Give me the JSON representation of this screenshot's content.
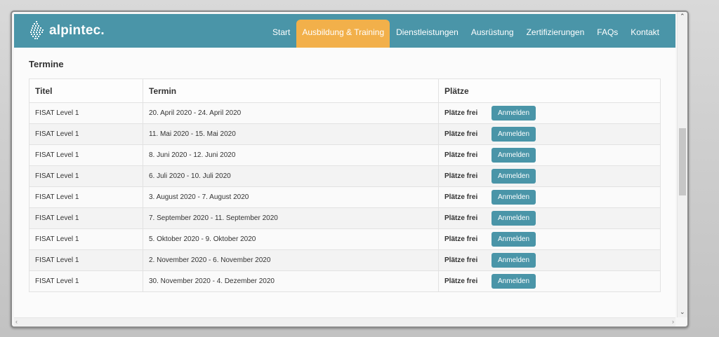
{
  "brand": {
    "name": "alpintec."
  },
  "nav": {
    "items": [
      {
        "label": "Start",
        "active": false
      },
      {
        "label": "Ausbildung & Training",
        "active": true
      },
      {
        "label": "Dienstleistungen",
        "active": false
      },
      {
        "label": "Ausrüstung",
        "active": false
      },
      {
        "label": "Zertifizierungen",
        "active": false
      },
      {
        "label": "FAQs",
        "active": false
      },
      {
        "label": "Kontakt",
        "active": false
      }
    ]
  },
  "section": {
    "title": "Termine"
  },
  "table": {
    "headers": [
      "Titel",
      "Termin",
      "Plätze"
    ],
    "rows": [
      {
        "titel": "FISAT Level 1",
        "termin": "20. April 2020 - 24. April 2020",
        "plaetze": "Plätze frei",
        "button": "Anmelden"
      },
      {
        "titel": "FISAT Level 1",
        "termin": "11. Mai 2020 - 15. Mai 2020",
        "plaetze": "Plätze frei",
        "button": "Anmelden"
      },
      {
        "titel": "FISAT Level 1",
        "termin": "8. Juni 2020 - 12. Juni 2020",
        "plaetze": "Plätze frei",
        "button": "Anmelden"
      },
      {
        "titel": "FISAT Level 1",
        "termin": "6. Juli 2020 - 10. Juli 2020",
        "plaetze": "Plätze frei",
        "button": "Anmelden"
      },
      {
        "titel": "FISAT Level 1",
        "termin": "3. August 2020 - 7. August 2020",
        "plaetze": "Plätze frei",
        "button": "Anmelden"
      },
      {
        "titel": "FISAT Level 1",
        "termin": "7. September 2020 - 11. September 2020",
        "plaetze": "Plätze frei",
        "button": "Anmelden"
      },
      {
        "titel": "FISAT Level 1",
        "termin": "5. Oktober 2020 - 9. Oktober 2020",
        "plaetze": "Plätze frei",
        "button": "Anmelden"
      },
      {
        "titel": "FISAT Level 1",
        "termin": "2. November 2020 - 6. November 2020",
        "plaetze": "Plätze frei",
        "button": "Anmelden"
      },
      {
        "titel": "FISAT Level 1",
        "termin": "30. November 2020 - 4. Dezember 2020",
        "plaetze": "Plätze frei",
        "button": "Anmelden"
      }
    ]
  },
  "colors": {
    "brand": "#4a95a8",
    "active_tab": "#f2b04a"
  },
  "icons": {
    "logo": "alpintec-logo-icon",
    "scroll_up": "chevron-up-icon",
    "scroll_down": "chevron-down-icon",
    "scroll_left": "chevron-left-icon",
    "scroll_right": "chevron-right-icon"
  }
}
